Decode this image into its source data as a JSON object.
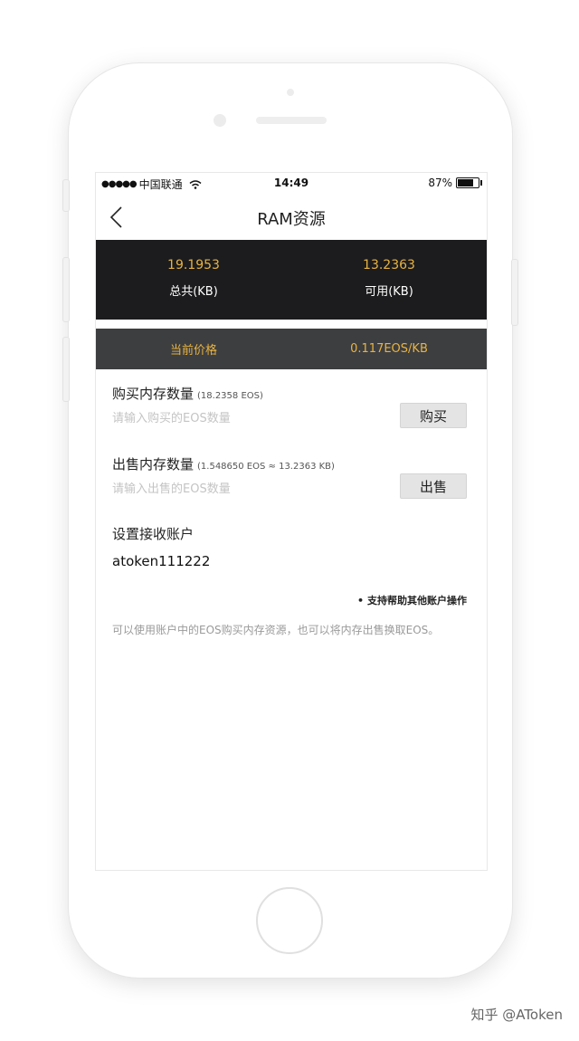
{
  "status_bar": {
    "signal": "●●●●●",
    "carrier": "中国联通",
    "time": "14:49",
    "battery": "87%",
    "battery_level": 0.87
  },
  "nav": {
    "title": "RAM资源",
    "back_icon": "chevron-left-icon"
  },
  "summary": {
    "total_value": "19.1953",
    "total_label": "总共(KB)",
    "available_value": "13.2363",
    "available_label": "可用(KB)"
  },
  "price": {
    "label": "当前价格",
    "value": "0.117EOS/KB"
  },
  "buy": {
    "label": "购买内存数量",
    "note": "(18.2358 EOS)",
    "placeholder": "请输入购买的EOS数量",
    "button": "购买"
  },
  "sell": {
    "label": "出售内存数量",
    "note": "(1.548650 EOS ≈ 13.2363 KB)",
    "placeholder": "请输入出售的EOS数量",
    "button": "出售"
  },
  "receiver": {
    "label": "设置接收账户",
    "value": "atoken111222"
  },
  "help": {
    "bullet": "•",
    "text": "支持帮助其他账户操作"
  },
  "description": "可以使用账户中的EOS购买内存资源，也可以将内存出售换取EOS。",
  "watermark": "知乎 @AToken",
  "colors": {
    "accent": "#e8b341",
    "summary_bg": "#1c1c1e",
    "price_bg": "#3d3e40"
  }
}
